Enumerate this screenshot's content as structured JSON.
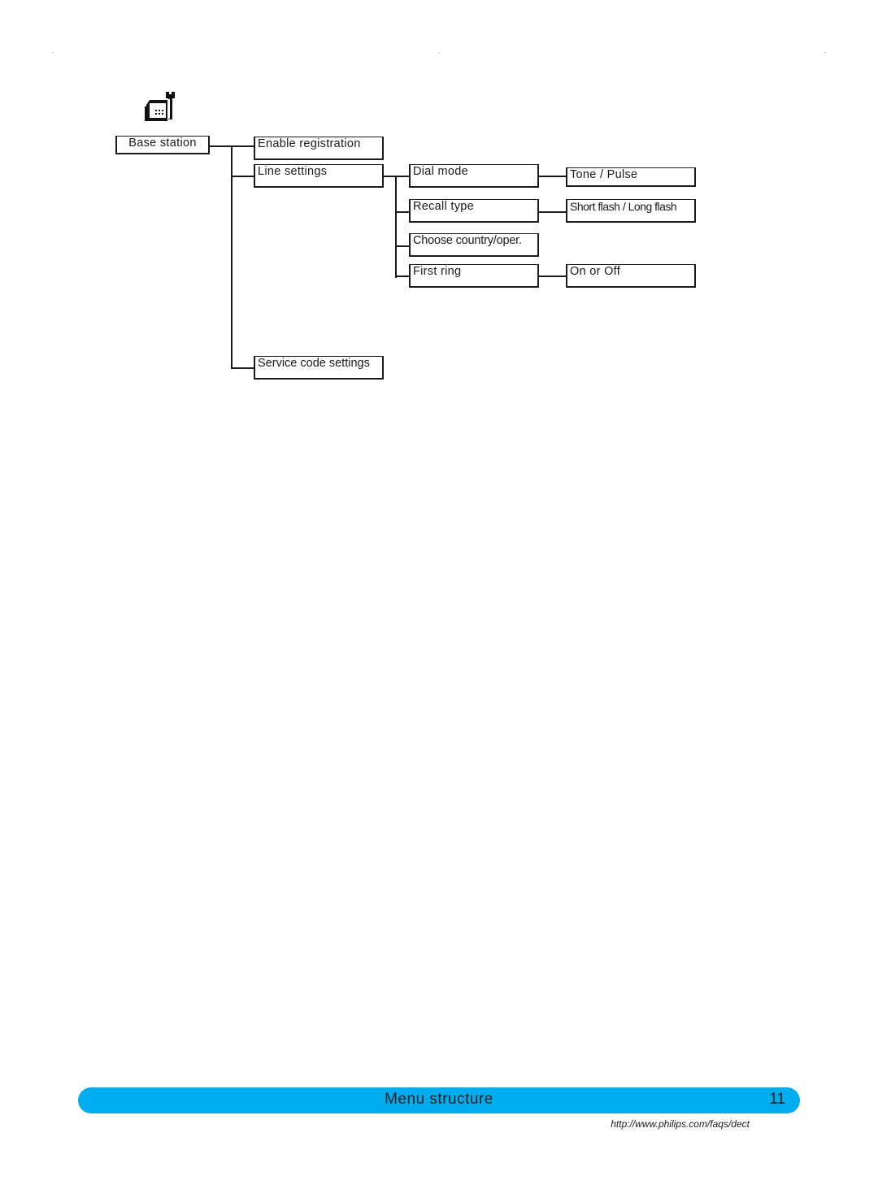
{
  "diagram": {
    "icon": "base-station-settings-icon",
    "root": {
      "label": "Base station"
    },
    "level1": [
      {
        "label": "Enable registration"
      },
      {
        "label": "Line settings"
      },
      {
        "label": "Service code settings"
      }
    ],
    "line_settings_children": [
      {
        "label": "Dial mode",
        "option": "Tone / Pulse"
      },
      {
        "label": "Recall type",
        "option": "Short flash / Long flash"
      },
      {
        "label": "Choose country/oper.",
        "option": null
      },
      {
        "label": "First ring",
        "option": "On or Off"
      }
    ]
  },
  "footer": {
    "title": "Menu structure",
    "page_number": "11",
    "url": "http://www.philips.com/faqs/dect",
    "accent_color": "#00aeef"
  }
}
